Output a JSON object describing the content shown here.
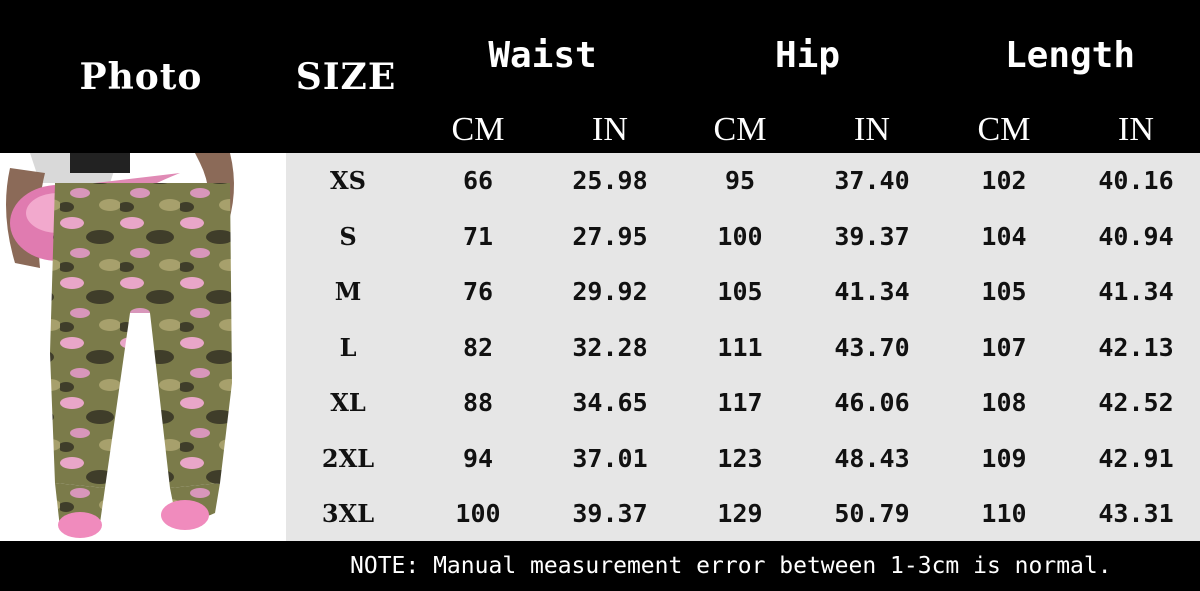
{
  "header": {
    "photo": "Photo",
    "size": "SIZE",
    "groups": [
      "Waist",
      "Hip",
      "Length"
    ],
    "units": [
      "CM",
      "IN",
      "CM",
      "IN",
      "CM",
      "IN"
    ]
  },
  "rows": [
    {
      "size": "XS",
      "values": [
        "66",
        "25.98",
        "95",
        "37.40",
        "102",
        "40.16"
      ]
    },
    {
      "size": "S",
      "values": [
        "71",
        "27.95",
        "100",
        "39.37",
        "104",
        "40.94"
      ]
    },
    {
      "size": "M",
      "values": [
        "76",
        "29.92",
        "105",
        "41.34",
        "105",
        "41.34"
      ]
    },
    {
      "size": "L",
      "values": [
        "82",
        "32.28",
        "111",
        "43.70",
        "107",
        "42.13"
      ]
    },
    {
      "size": "XL",
      "values": [
        "88",
        "34.65",
        "117",
        "46.06",
        "108",
        "42.52"
      ]
    },
    {
      "size": "2XL",
      "values": [
        "94",
        "37.01",
        "123",
        "48.43",
        "109",
        "42.91"
      ]
    },
    {
      "size": "3XL",
      "values": [
        "100",
        "39.37",
        "129",
        "50.79",
        "110",
        "43.31"
      ]
    }
  ],
  "note": "NOTE: Manual measurement error between 1-3cm is normal.",
  "colors": {
    "header_bg": "#000000",
    "table_bg": "#e6e6e6",
    "camo_green": "#7b7b4a",
    "camo_pink": "#e9a6c8"
  }
}
